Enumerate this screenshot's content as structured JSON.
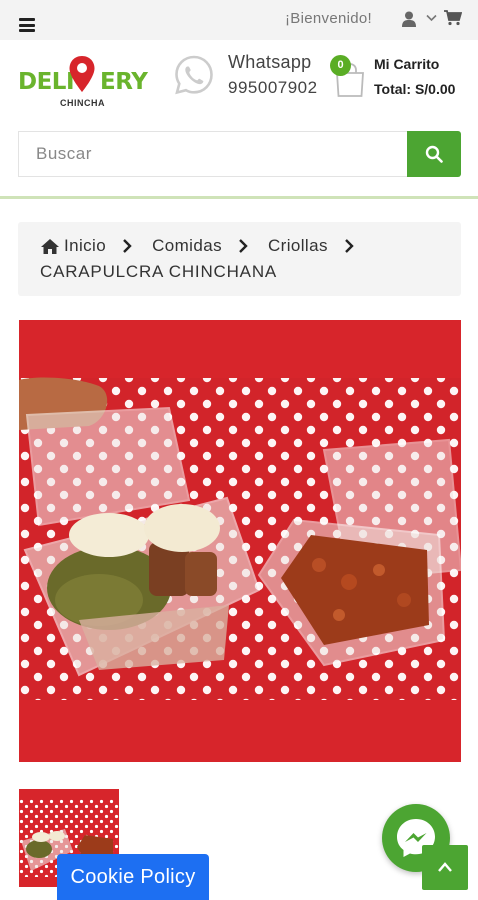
{
  "topbar": {
    "welcome": "¡Bienvenido!",
    "icons": [
      "menu-icon",
      "user-icon",
      "chevron-down-icon",
      "cart-icon"
    ]
  },
  "header": {
    "logo_text_left": "DELI",
    "logo_text_right": "ERY",
    "logo_sub": "CHINCHA",
    "whatsapp_label": "Whatsapp",
    "whatsapp_number": "995007902",
    "cart_count": "0",
    "cart_title": "Mi Carrito",
    "cart_total": "Total: S/0.00"
  },
  "search": {
    "placeholder": "Buscar"
  },
  "breadcrumb": {
    "items": [
      {
        "label": "Inicio",
        "icon": "home-icon"
      },
      {
        "label": "Comidas"
      },
      {
        "label": "Criollas"
      }
    ],
    "current": "CARAPULCRA CHINCHANA"
  },
  "product": {
    "image_description_icon": "product-photo"
  },
  "floating": {
    "cookie_label": "Cookie Policy"
  },
  "colors": {
    "brand_green": "#4ca532",
    "logo_green": "#6ab42d",
    "logo_pin_red": "#d7252b",
    "photo_red": "#d7252b",
    "cookie_blue": "#1d6ff2",
    "breadcrumb_bg": "#f4f4f4"
  }
}
